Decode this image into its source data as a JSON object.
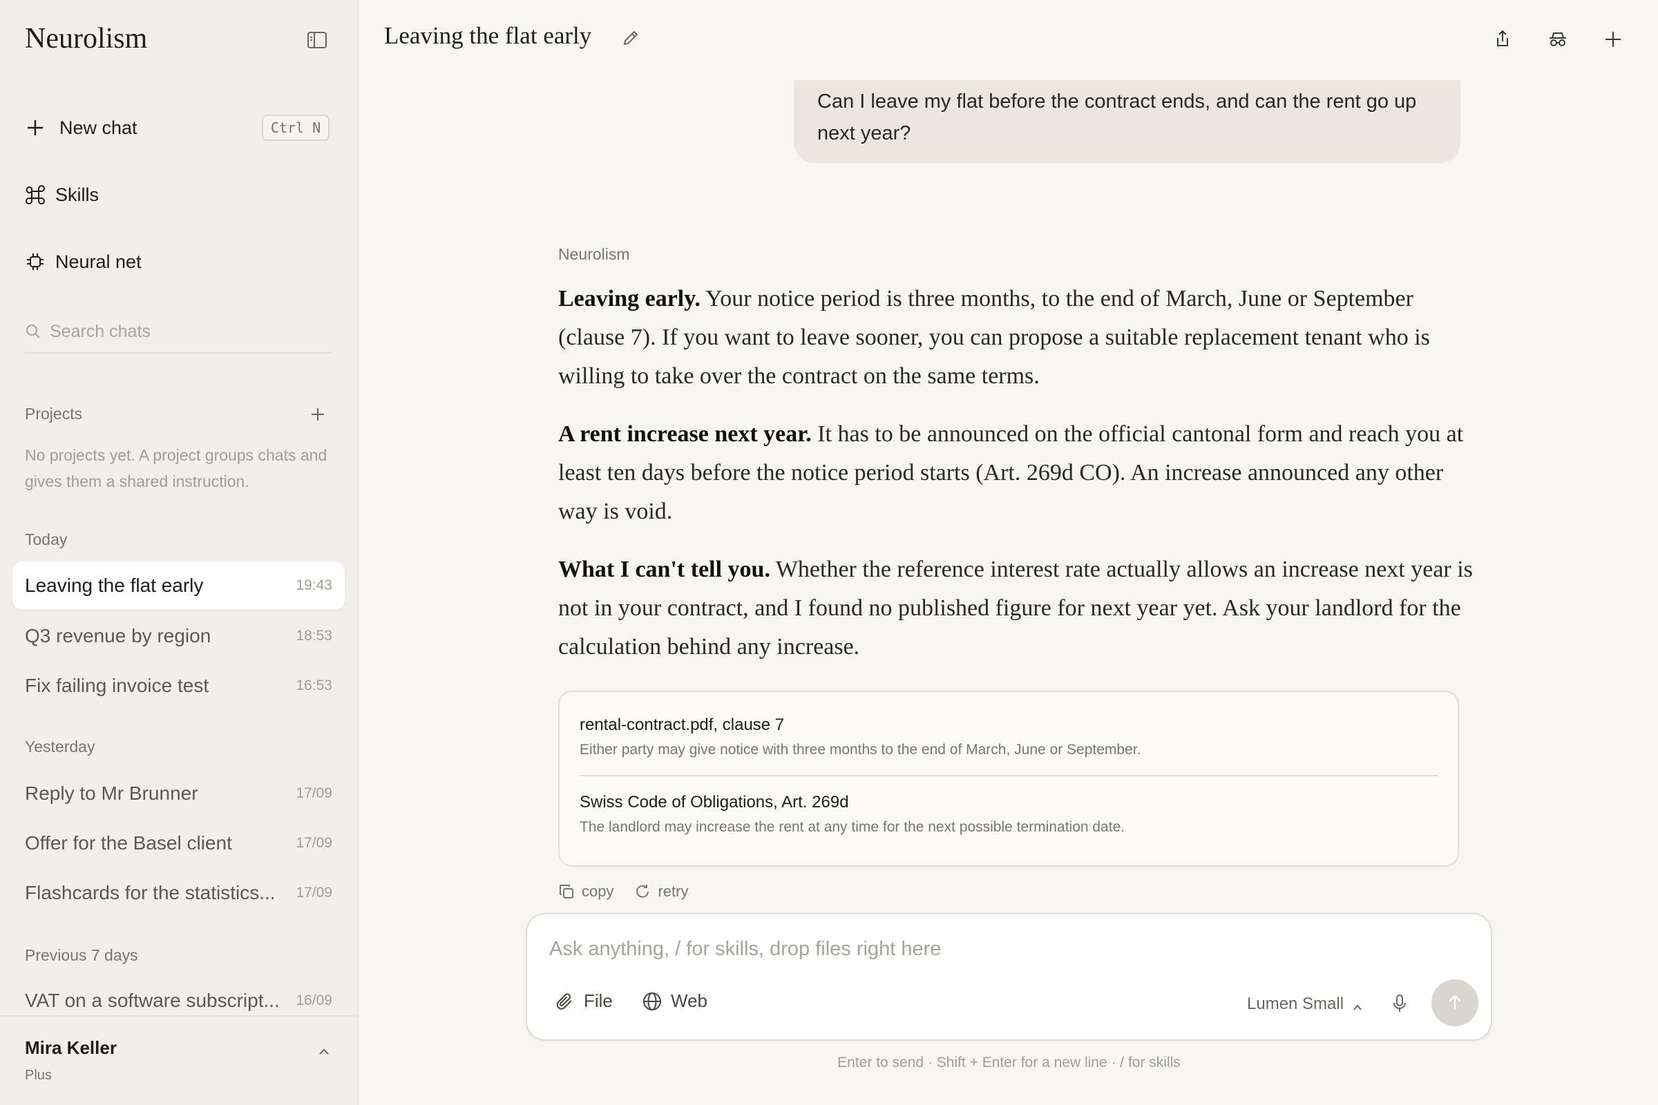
{
  "sidebar": {
    "brand": "Neurolism",
    "new_chat": {
      "label": "New chat",
      "shortcut": "Ctrl N"
    },
    "skills_label": "Skills",
    "neural_net_label": "Neural net",
    "search_placeholder": "Search chats",
    "projects": {
      "label": "Projects",
      "empty_text": "No projects yet. A project groups chats and gives them a shared instruction."
    },
    "sections": {
      "today": "Today",
      "yesterday": "Yesterday",
      "previous": "Previous 7 days"
    },
    "chats": [
      {
        "title": "Leaving the flat early",
        "time": "19:43",
        "active": true
      },
      {
        "title": "Q3 revenue by region",
        "time": "18:53"
      },
      {
        "title": "Fix failing invoice test",
        "time": "16:53"
      },
      {
        "title": "Reply to Mr Brunner",
        "time": "17/09"
      },
      {
        "title": "Offer for the Basel client",
        "time": "17/09"
      },
      {
        "title": "Flashcards for the statistics...",
        "time": "17/09"
      },
      {
        "title": "VAT on a software subscript...",
        "time": "16/09"
      }
    ],
    "user": {
      "name": "Mira Keller",
      "plan": "Plus"
    }
  },
  "header": {
    "title": "Leaving the flat early"
  },
  "conversation": {
    "user_message": "Can I leave my flat before the contract ends, and can the rent go up next year?",
    "assistant_label": "Neurolism",
    "paragraphs": [
      {
        "lead": "Leaving early.",
        "text": " Your notice period is three months, to the end of March, June or September (clause 7). If you want to leave sooner, you can propose a suitable replacement tenant who is willing to take over the contract on the same terms."
      },
      {
        "lead": "A rent increase next year.",
        "text": " It has to be announced on the official cantonal form and reach you at least ten days before the notice period starts (Art. 269d CO). An increase announced any other way is void."
      },
      {
        "lead": "What I can't tell you.",
        "text": " Whether the reference interest rate actually allows an increase next year is not in your contract, and I found no published figure for next year yet. Ask your landlord for the calculation behind any increase."
      }
    ],
    "sources": [
      {
        "title": "rental-contract.pdf, clause 7",
        "excerpt": "Either party may give notice with three months to the end of March, June or September."
      },
      {
        "title": "Swiss Code of Obligations, Art. 269d",
        "excerpt": "The landlord may increase the rent at any time for the next possible termination date."
      }
    ],
    "actions": {
      "copy": "copy",
      "retry": "retry"
    }
  },
  "composer": {
    "placeholder": "Ask anything, / for skills, drop files right here",
    "file_label": "File",
    "web_label": "Web",
    "model": "Lumen Small",
    "hint": "Enter to send · Shift + Enter for a new line · / for skills"
  }
}
